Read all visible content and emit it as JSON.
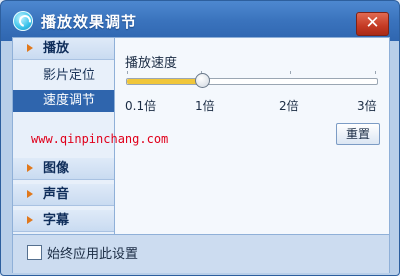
{
  "window": {
    "title": "播放效果调节",
    "close_glyph": "✕"
  },
  "sidebar": {
    "playback": {
      "label": "播放",
      "items": [
        "影片定位",
        "速度调节"
      ],
      "active_item": "速度调节"
    },
    "sections": [
      "图像",
      "声音",
      "字幕"
    ]
  },
  "speed": {
    "label": "播放速度",
    "ticks": [
      "0.1倍",
      "1倍",
      "2倍",
      "3倍"
    ],
    "current_value_fraction": 0.3,
    "fill_color": "#f0c63a",
    "reset_label": "重置"
  },
  "watermark": "www.qinpinchang.com",
  "footer": {
    "checkbox_label": "始终应用此设置",
    "checked": false
  },
  "colors": {
    "title_bar": "#3a73bd",
    "active_item": "#2f65ad",
    "close_button": "#c43a24",
    "watermark": "#e0001b"
  }
}
